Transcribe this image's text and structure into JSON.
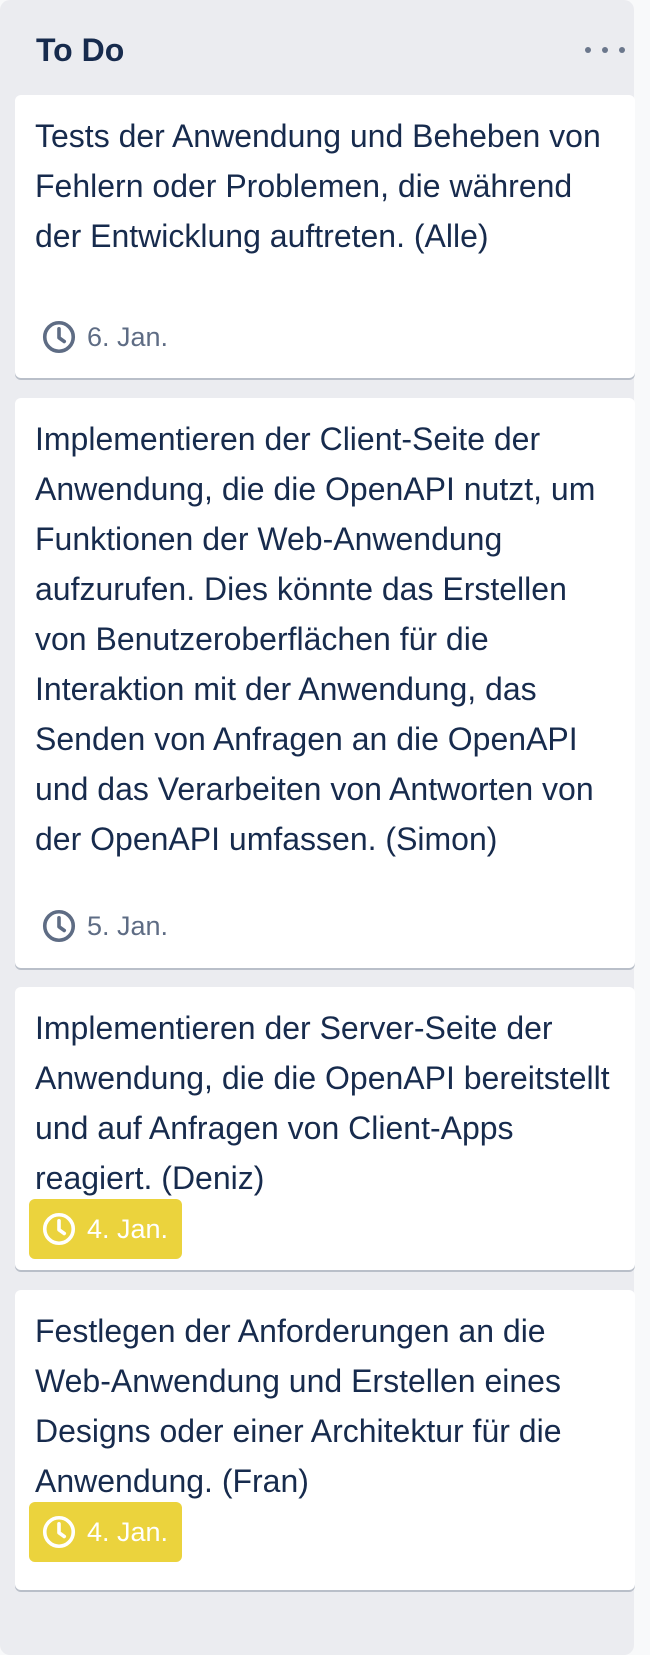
{
  "list": {
    "title": "To Do",
    "menu_icon": "more-horizontal-icon"
  },
  "cards": [
    {
      "text": "Tests der Anwendung und Beheben von Fehlern oder Problemen, die während der Entwicklung auftreten. (Alle)",
      "due": "6. Jan.",
      "due_icon": "clock-icon",
      "due_status": "normal"
    },
    {
      "text": "Implementieren der Client-Seite der Anwendung, die die OpenAPI nutzt, um Funktionen der Web-Anwendung aufzurufen. Dies könnte das Erstellen von Benutzeroberflächen für die Interaktion mit der Anwendung, das Senden von Anfragen an die OpenAPI und das Verarbeiten von Antworten von der OpenAPI umfassen. (Simon)",
      "due": "5. Jan.",
      "due_icon": "clock-icon",
      "due_status": "normal"
    },
    {
      "text": "Implementieren der Server-Seite der Anwendung, die die OpenAPI bereitstellt und auf Anfragen von Client-Apps reagiert. (Deniz)",
      "due": "4. Jan.",
      "due_icon": "clock-icon",
      "due_status": "due-soon"
    },
    {
      "text": "Festlegen der Anforderungen an die Web-Anwendung und Erstellen eines Designs oder einer Architektur für die Anwendung. (Fran)",
      "due": "4. Jan.",
      "due_icon": "clock-icon",
      "due_status": "due-soon"
    }
  ],
  "colors": {
    "list_background": "#ebecf0",
    "card_background": "#ffffff",
    "text": "#172b4d",
    "muted": "#5e6c84",
    "due_soon": "#ebd33d"
  }
}
